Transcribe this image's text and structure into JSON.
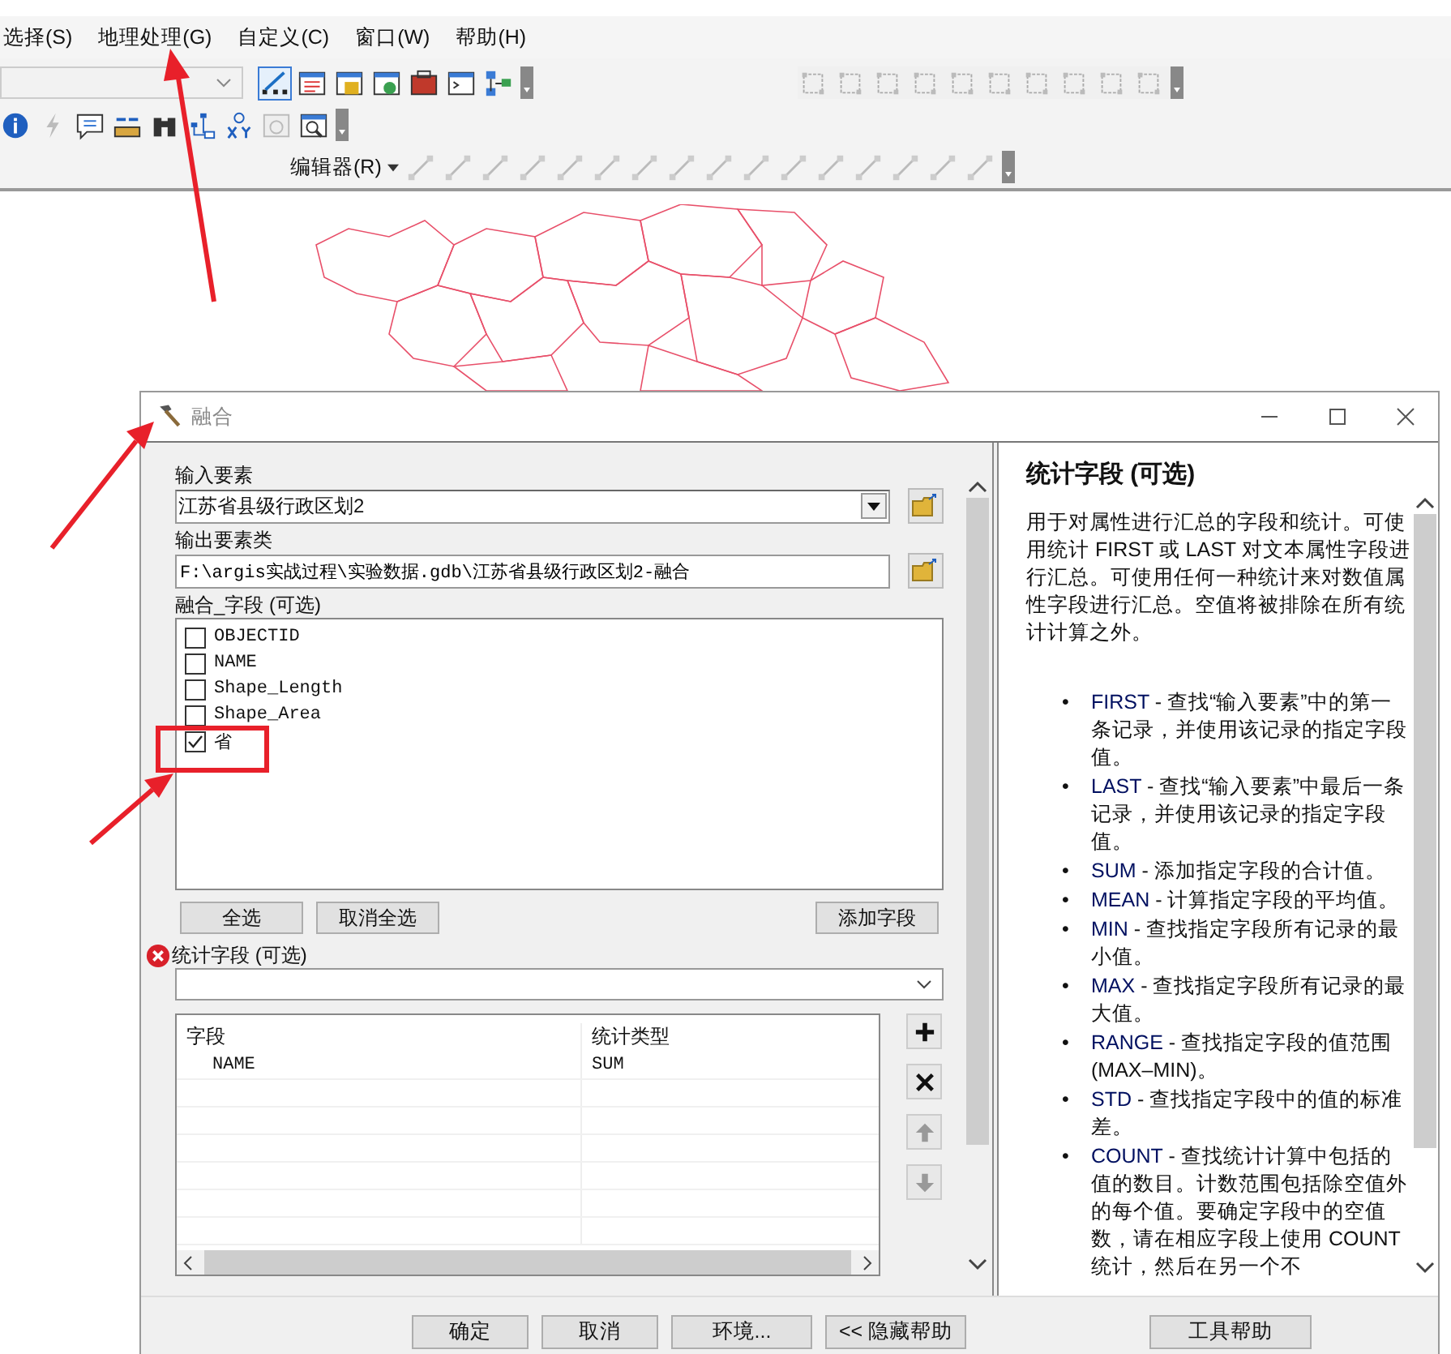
{
  "menu": [
    "选择(S)",
    "地理处理(G)",
    "自定义(C)",
    "窗口(W)",
    "帮助(H)"
  ],
  "editor_toolbar": {
    "menu": "编辑器(R)"
  },
  "dialog": {
    "title": "融合",
    "input": {
      "label": "输入要素",
      "value": "江苏省县级行政区划2"
    },
    "output": {
      "label": "输出要素类",
      "value": "F:\\argis实战过程\\实验数据.gdb\\江苏省县级行政区划2-融合"
    },
    "dissolve_fields": {
      "label": "融合_字段 (可选)",
      "items": [
        {
          "name": "OBJECTID",
          "checked": false
        },
        {
          "name": "NAME",
          "checked": false
        },
        {
          "name": "Shape_Length",
          "checked": false
        },
        {
          "name": "Shape_Area",
          "checked": false
        },
        {
          "name": "省",
          "checked": true
        }
      ]
    },
    "list_buttons": [
      "全选",
      "取消全选"
    ],
    "add_field_button": "添加字段",
    "statistics": {
      "label": "统计字段 (可选)",
      "error": true,
      "columns": [
        "字段",
        "统计类型"
      ],
      "rows": [
        [
          "NAME",
          "SUM"
        ]
      ],
      "side_buttons": [
        {
          "kind": "add",
          "disabled": false
        },
        {
          "kind": "remove",
          "disabled": false
        },
        {
          "kind": "up",
          "disabled": true
        },
        {
          "kind": "down",
          "disabled": true
        }
      ]
    },
    "buttons": [
      "确定",
      "取消",
      "环境...",
      "<< 隐藏帮助"
    ],
    "help": {
      "title": "统计字段 (可选)",
      "intro": "用于对属性进行汇总的字段和统计。可使用统计 FIRST 或 LAST 对文本属性字段进行汇总。可使用任何一种统计来对数值属性字段进行汇总。空值将被排除在所有统计计算之外。",
      "items": [
        {
          "marker": "•",
          "term": "FIRST",
          "text": " - 查找“输入要素”中的第一条记录，并使用该记录的指定字段值。"
        },
        {
          "marker": "•",
          "term": "LAST",
          "text": " - 查找“输入要素”中最后一条记录，并使用该记录的指定字段值。"
        },
        {
          "marker": "•",
          "term": "SUM",
          "text": " - 添加指定字段的合计值。"
        },
        {
          "marker": "•",
          "term": "MEAN",
          "text": " - 计算指定字段的平均值。"
        },
        {
          "marker": "•",
          "term": "MIN",
          "text": " - 查找指定字段所有记录的最小值。"
        },
        {
          "marker": "•",
          "term": "MAX",
          "text": " - 查找指定字段所有记录的最大值。"
        },
        {
          "marker": "•",
          "term": "RANGE",
          "text": " - 查找指定字段的值范围 (MAX–MIN)。"
        },
        {
          "marker": "•",
          "term": "STD",
          "text": " - 查找指定字段中的值的标准差。"
        },
        {
          "marker": "•",
          "term": "COUNT",
          "text": " - 查找统计计算中包括的值的数目。计数范围包括除空值外的每个值。要确定字段中的空值数，请在相应字段上使用 COUNT 统计，然后在另一个不"
        }
      ],
      "button": "工具帮助"
    }
  }
}
